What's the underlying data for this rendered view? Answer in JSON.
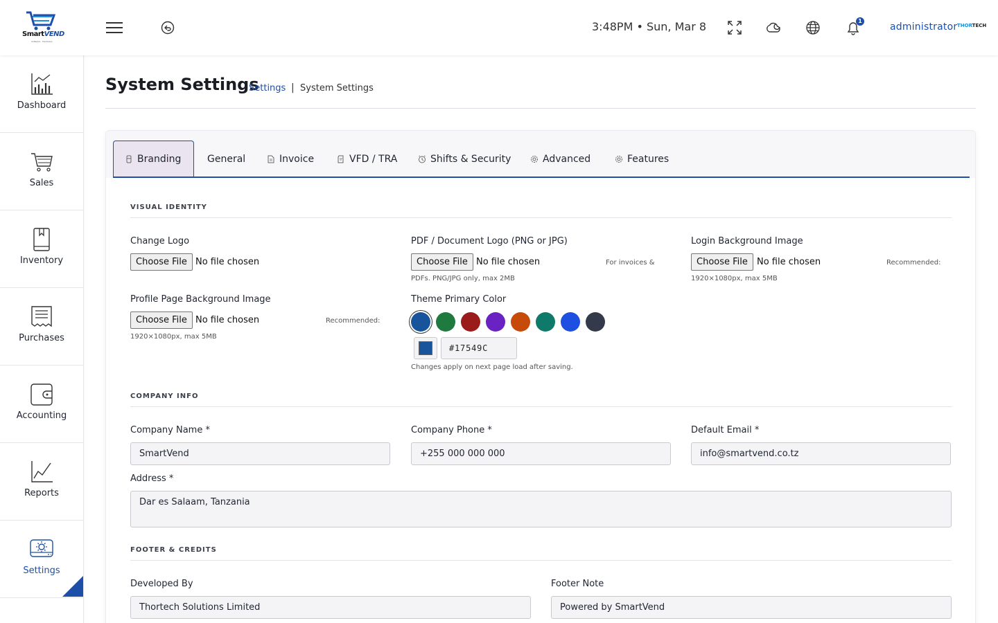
{
  "header": {
    "logo_brand_a": "Smart",
    "logo_brand_b": "VEND",
    "logo_tagline": "Software · Hardware",
    "clock": "3:48PM • Sun, Mar 8",
    "notification_count": "1",
    "username": "administrator",
    "partner_logo_a": "THOR",
    "partner_logo_b": "TECH",
    "icons": [
      "menu-icon",
      "back-icon",
      "fullscreen-icon",
      "weather-icon",
      "globe-icon",
      "bell-icon"
    ]
  },
  "sidebar": {
    "active_color": "#1d4fa8",
    "items": [
      {
        "label": "Dashboard",
        "icon": "dashboard-chart-icon"
      },
      {
        "label": "Sales",
        "icon": "cart-icon"
      },
      {
        "label": "Inventory",
        "icon": "book-icon"
      },
      {
        "label": "Purchases",
        "icon": "receipt-icon"
      },
      {
        "label": "Accounting",
        "icon": "wallet-icon"
      },
      {
        "label": "Reports",
        "icon": "line-chart-icon"
      },
      {
        "label": "Settings",
        "icon": "settings-icon",
        "active": true
      }
    ]
  },
  "page": {
    "title": "System Settings",
    "breadcrumb_link": "Settings",
    "breadcrumb_sep": "|",
    "breadcrumb_current": "System Settings"
  },
  "tabs": [
    {
      "label": "Branding",
      "icon": "paint-icon",
      "active": true
    },
    {
      "label": "General"
    },
    {
      "label": "Invoice",
      "icon": "file-icon"
    },
    {
      "label": "VFD / TRA",
      "icon": "document-icon"
    },
    {
      "label": "Shifts & Security",
      "icon": "clock-icon"
    },
    {
      "label": "Advanced",
      "icon": "gear-icon"
    },
    {
      "label": "Features",
      "icon": "cog-icon"
    }
  ],
  "branding": {
    "visual_identity_heading": "VISUAL IDENTITY",
    "file_button": "Choose File",
    "no_file": "No file chosen",
    "change_logo_label": "Change Logo",
    "pdf_logo_label": "PDF / Document Logo (PNG or JPG)",
    "pdf_logo_hint_a": "For invoices &",
    "pdf_logo_hint_b": "PDFs. PNG/JPG only, max 2MB",
    "login_bg_label": "Login Background Image",
    "login_bg_hint_a": "Recommended:",
    "login_bg_hint_b": "1920×1080px, max 5MB",
    "profile_bg_label": "Profile Page Background Image",
    "profile_bg_hint_a": "Recommended:",
    "profile_bg_hint_b": "1920×1080px, max 5MB",
    "theme_color_label": "Theme Primary Color",
    "theme_swatches": [
      "#17549c",
      "#1e7a3e",
      "#9b1b1b",
      "#6a22c2",
      "#c64a0a",
      "#0f7a6a",
      "#1f4fe0",
      "#343a4a"
    ],
    "theme_color_value": "#17549C",
    "theme_color_hint": "Changes apply on next page load after saving."
  },
  "company": {
    "heading": "COMPANY INFO",
    "name_label": "Company Name *",
    "name_value": "SmartVend",
    "phone_label": "Company Phone *",
    "phone_value": "+255 000 000 000",
    "email_label": "Default Email *",
    "email_value": "info@smartvend.co.tz",
    "address_label": "Address *",
    "address_value": "Dar es Salaam, Tanzania"
  },
  "footer": {
    "heading": "FOOTER & CREDITS",
    "developed_label": "Developed By",
    "developed_value": "Thortech Solutions Limited",
    "note_label": "Footer Note",
    "note_value": "Powered by SmartVend"
  }
}
